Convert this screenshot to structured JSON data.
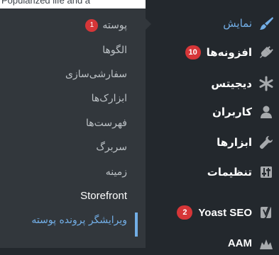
{
  "background_text": "Popularized life and a",
  "submenu": {
    "items": [
      {
        "label": "پوسته",
        "badge": "1"
      },
      {
        "label": "الگوها"
      },
      {
        "label": "سفارشی‌سازی"
      },
      {
        "label": "ابزارک‌ها"
      },
      {
        "label": "فهرست‌ها"
      },
      {
        "label": "سربرگ"
      },
      {
        "label": "زمینه"
      },
      {
        "label": "Storefront"
      },
      {
        "label": "ویرایشگر پرونده پوسته"
      }
    ]
  },
  "menu": {
    "items": [
      {
        "label": "نمایش",
        "icon": "paintbrush-icon"
      },
      {
        "label": "افزونه‌ها",
        "badge": "10",
        "icon": "plugins-icon"
      },
      {
        "label": "دیجیتس",
        "icon": "asterisk-icon"
      },
      {
        "label": "کاربران",
        "icon": "users-icon"
      },
      {
        "label": "ابزارها",
        "icon": "wrench-icon"
      },
      {
        "label": "تنظیمات",
        "icon": "settings-icon"
      },
      {
        "label": "Yoast SEO",
        "badge": "2",
        "icon": "yoast-icon"
      },
      {
        "label": "AAM",
        "icon": "aam-icon"
      }
    ]
  },
  "colors": {
    "menu_bg": "#23282d",
    "submenu_bg": "#32373c",
    "accent": "#72aee6",
    "badge": "#d63638"
  }
}
